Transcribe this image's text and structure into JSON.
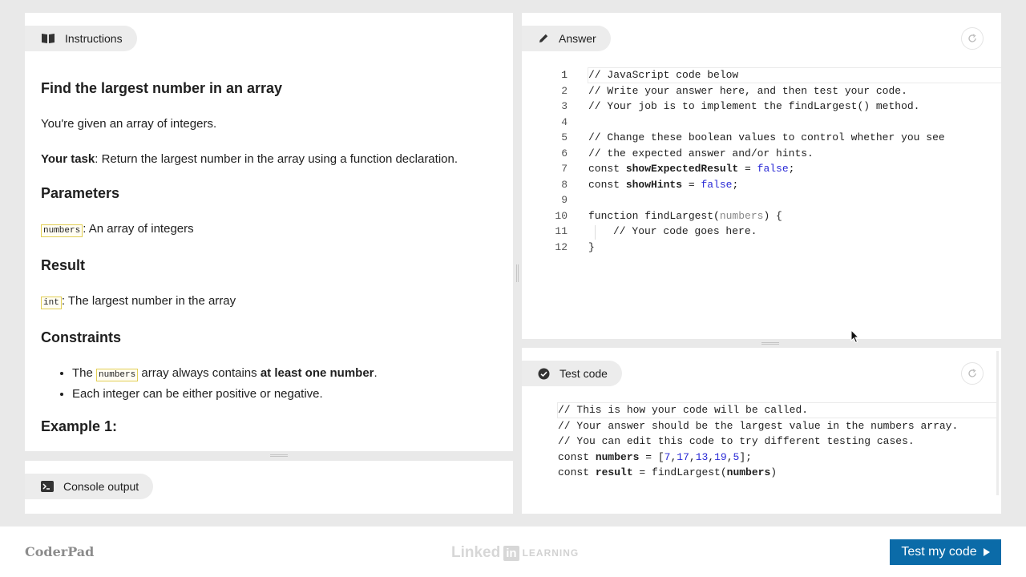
{
  "instructions": {
    "tab_label": "Instructions",
    "title": "Find the largest number in an array",
    "intro": "You're given an array of integers.",
    "task_label": "Your task",
    "task_text": ": Return the largest number in the array using a function declaration.",
    "parameters_heading": "Parameters",
    "param_name": "numbers",
    "param_desc": ": An array of integers",
    "result_heading": "Result",
    "result_type": "int",
    "result_desc": ": The largest number in the array",
    "constraints_heading": "Constraints",
    "constraint1_pre": "The ",
    "constraint1_code": "numbers",
    "constraint1_mid": " array always contains ",
    "constraint1_bold": "at least one number",
    "constraint1_post": ".",
    "constraint2": "Each integer can be either positive or negative.",
    "example_heading": "Example 1:"
  },
  "console": {
    "tab_label": "Console output"
  },
  "answer": {
    "tab_label": "Answer",
    "line_numbers": [
      "1",
      "2",
      "3",
      "4",
      "5",
      "6",
      "7",
      "8",
      "9",
      "10",
      "11",
      "12"
    ],
    "lines": {
      "l1": "// JavaScript code below",
      "l2": "// Write your answer here, and then test your code.",
      "l3": "// Your job is to implement the findLargest() method.",
      "l5": "// Change these boolean values to control whether you see",
      "l6": "// the expected answer and/or hints.",
      "l7_kw": "const ",
      "l7_var": "showExpectedResult",
      "l7_eq": " = ",
      "l7_val": "false",
      "l7_end": ";",
      "l8_kw": "const ",
      "l8_var": "showHints",
      "l8_eq": " = ",
      "l8_val": "false",
      "l8_end": ";",
      "l10_fn": "function findLargest(",
      "l10_param": "numbers",
      "l10_end": ") {",
      "l11": "// Your code goes here.",
      "l12": "}"
    }
  },
  "test": {
    "tab_label": "Test code",
    "lines": {
      "t1": "// This is how your code will be called.",
      "t2": "// Your answer should be the largest value in the numbers array.",
      "t3": "// You can edit this code to try different testing cases.",
      "t4_kw": "const ",
      "t4_var": "numbers",
      "t4_eq": " = [",
      "t4_vals": [
        "7",
        "17",
        "13",
        "19",
        "5"
      ],
      "t4_end": "];",
      "t5_kw": "const ",
      "t5_var": "result",
      "t5_eq": " = findLargest(",
      "t5_arg": "numbers",
      "t5_end": ")"
    }
  },
  "footer": {
    "brand": "CoderPad",
    "logo_word": "Linked",
    "logo_in": "in",
    "logo_learning": "LEARNING",
    "run_button": "Test my code"
  }
}
